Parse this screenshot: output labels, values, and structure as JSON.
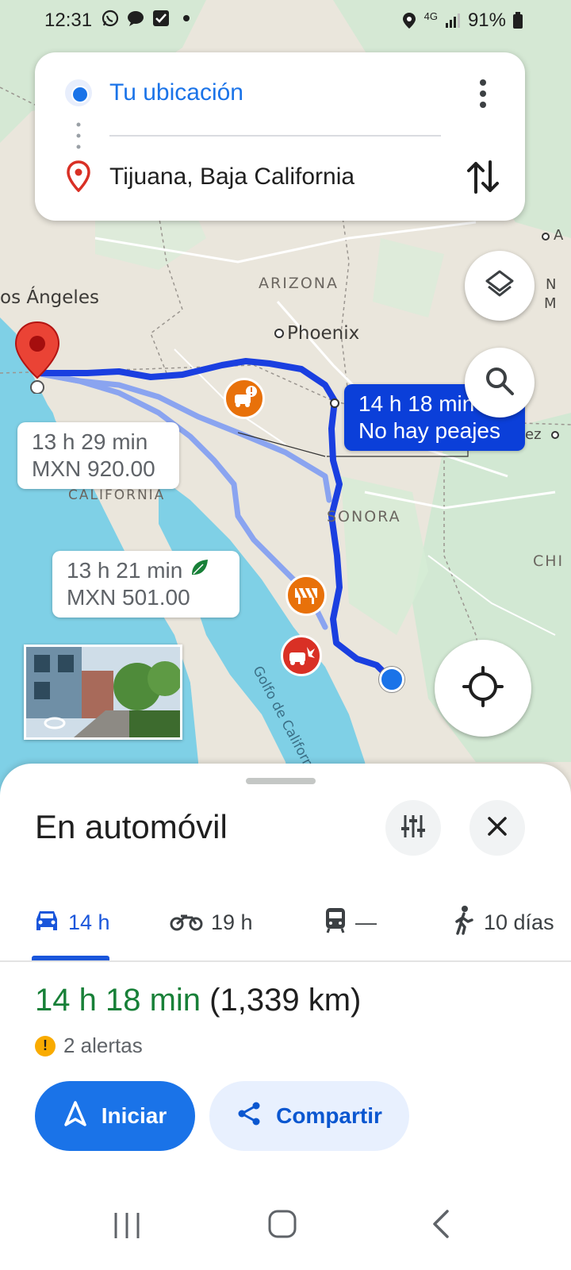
{
  "status_bar": {
    "time": "12:31",
    "battery": "91%",
    "network": "4G",
    "left_icons": [
      "whatsapp-icon",
      "chat-bubble-icon",
      "checkbox-icon",
      "dot-icon"
    ],
    "right_icons": [
      "location-icon",
      "signal-icon",
      "battery-icon"
    ]
  },
  "route_card": {
    "origin": "Tu ubicación",
    "destination": "Tijuana, Baja California",
    "icons": [
      "origin-dot-icon",
      "destination-pin-icon",
      "more-vert-icon",
      "swap-icon"
    ]
  },
  "map": {
    "labels": {
      "arizona": "ARIZONA",
      "phoenix": "Phoenix",
      "los_angeles": "os Ángeles",
      "sonora": "SONORA",
      "california": "CALIFORNIA",
      "gulf": "Golfo de California",
      "chi": "CHI",
      "edge_a": "A",
      "edge_n": "N",
      "edge_m": "M",
      "edge_ez": "ez"
    },
    "routes": [
      {
        "time": "14 h 18 min",
        "detail": "No hay peajes",
        "selected": true
      },
      {
        "time": "13 h 29 min",
        "detail": "MXN 920.00",
        "selected": false
      },
      {
        "time": "13 h 21 min",
        "detail": "MXN 501.00",
        "selected": false,
        "eco": true
      }
    ],
    "buttons": [
      "layers-icon",
      "search-icon",
      "my-location-icon"
    ],
    "thumbnail": "street-view-thumbnail",
    "colors": {
      "route_selected": "#1a3fe0",
      "route_alt": "#8aa4f0",
      "water": "#7fd0e6",
      "land": "#eae6dc",
      "green": "#cfe8d2"
    }
  },
  "sheet": {
    "title": "En automóvil",
    "modes": [
      {
        "icon": "car-icon",
        "label": "14 h",
        "active": true
      },
      {
        "icon": "motorcycle-icon",
        "label": "19 h",
        "active": false
      },
      {
        "icon": "transit-icon",
        "label": "—",
        "active": false
      },
      {
        "icon": "walk-icon",
        "label": "10 días",
        "active": false
      }
    ],
    "summary_time": "14 h 18 min",
    "summary_distance": "(1,339 km)",
    "alerts": "2 alertas",
    "alert_badge": "!",
    "start_label": "Iniciar",
    "share_label": "Compartir"
  }
}
